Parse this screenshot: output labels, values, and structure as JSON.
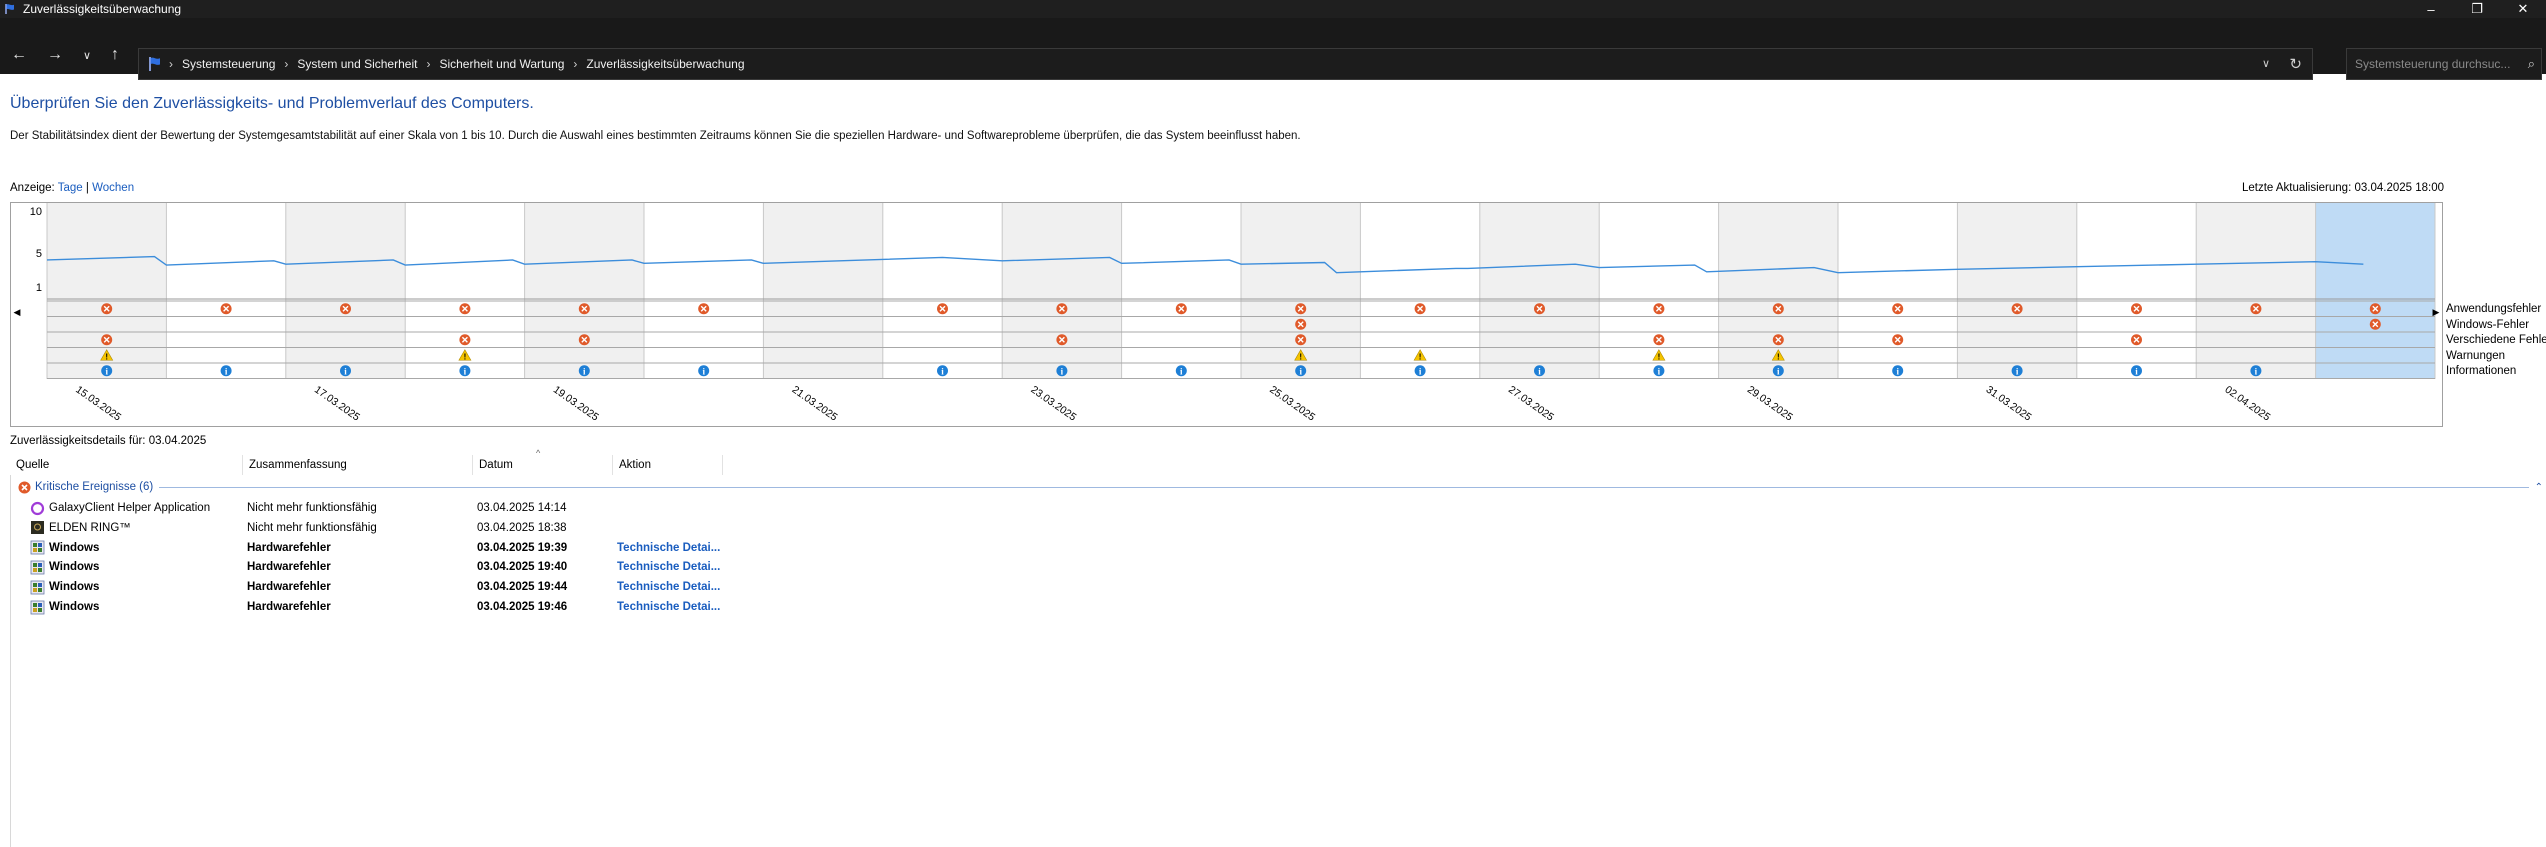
{
  "window": {
    "title": "Zuverlässigkeitsüberwachung"
  },
  "address": {
    "breadcrumbs": [
      "Systemsteuerung",
      "System und Sicherheit",
      "Sicherheit und Wartung",
      "Zuverlässigkeitsüberwachung"
    ],
    "search_placeholder": "Systemsteuerung durchsuc..."
  },
  "page": {
    "heading": "Überprüfen Sie den Zuverlässigkeits- und Problemverlauf des Computers.",
    "description": "Der Stabilitätsindex dient der Bewertung der Systemgesamtstabilität auf einer Skala von 1 bis 10. Durch die Auswahl eines bestimmten Zeitraums können Sie die speziellen Hardware- und Softwareprobleme überprüfen, die das System beeinflusst haben.",
    "view_label": "Anzeige:",
    "view_days": "Tage",
    "view_sep": "|",
    "view_weeks": "Wochen",
    "last_update": "Letzte Aktualisierung: 03.04.2025 18:00"
  },
  "chart_data": {
    "type": "line",
    "ylim": [
      1,
      10
    ],
    "yticks": [
      "10",
      "5",
      "1"
    ],
    "dates": [
      "15.03.2025",
      "16.03.2025",
      "17.03.2025",
      "18.03.2025",
      "19.03.2025",
      "20.03.2025",
      "21.03.2025",
      "22.03.2025",
      "23.03.2025",
      "24.03.2025",
      "25.03.2025",
      "26.03.2025",
      "27.03.2025",
      "28.03.2025",
      "29.03.2025",
      "30.03.2025",
      "31.03.2025",
      "01.04.2025",
      "02.04.2025",
      "03.04.2025"
    ],
    "date_labels": [
      "15.03.2025",
      "17.03.2025",
      "19.03.2025",
      "21.03.2025",
      "23.03.2025",
      "25.03.2025",
      "27.03.2025",
      "29.03.2025",
      "31.03.2025",
      "02.04.2025"
    ],
    "stability_index": [
      [
        0,
        4.2
      ],
      [
        0.9,
        4.6
      ],
      [
        1.0,
        3.6
      ],
      [
        1.9,
        4.1
      ],
      [
        2.0,
        3.7
      ],
      [
        2.9,
        4.2
      ],
      [
        3.0,
        3.6
      ],
      [
        3.9,
        4.2
      ],
      [
        4.0,
        3.7
      ],
      [
        4.9,
        4.2
      ],
      [
        5.0,
        3.8
      ],
      [
        5.9,
        4.2
      ],
      [
        6.0,
        3.8
      ],
      [
        7.5,
        4.5
      ],
      [
        8.0,
        4.1
      ],
      [
        8.9,
        4.5
      ],
      [
        9.0,
        3.8
      ],
      [
        9.9,
        4.2
      ],
      [
        10.0,
        3.7
      ],
      [
        10.7,
        3.9
      ],
      [
        10.8,
        2.7
      ],
      [
        11.8,
        3.2
      ],
      [
        11.9,
        3.2
      ],
      [
        12.8,
        3.7
      ],
      [
        13.0,
        3.3
      ],
      [
        13.8,
        3.6
      ],
      [
        13.9,
        2.8
      ],
      [
        14.8,
        3.3
      ],
      [
        15.0,
        2.7
      ],
      [
        16.0,
        3.1
      ],
      [
        17.0,
        3.4
      ],
      [
        18.0,
        3.7
      ],
      [
        19.0,
        4.0
      ],
      [
        19.4,
        3.7
      ]
    ],
    "selected_index": 19,
    "row_labels": [
      "Anwendungsfehler",
      "Windows-Fehler",
      "Verschiedene Fehle",
      "Warnungen",
      "Informationen"
    ],
    "events": {
      "Anwendungsfehler": [
        0,
        1,
        2,
        3,
        4,
        5,
        7,
        8,
        9,
        10,
        11,
        12,
        13,
        14,
        15,
        16,
        17,
        18,
        19
      ],
      "Windows-Fehler": [
        10,
        19
      ],
      "Verschiedene Fehle": [
        0,
        3,
        4,
        8,
        10,
        13,
        14,
        15,
        17
      ],
      "Warnungen": [
        0,
        3,
        10,
        11,
        13,
        14
      ],
      "Informationen": [
        0,
        1,
        2,
        3,
        4,
        5,
        7,
        8,
        9,
        10,
        11,
        12,
        13,
        14,
        15,
        16,
        17,
        18
      ]
    },
    "colors": {
      "line": "#3c8ddb",
      "error": "#e05a2a",
      "warning": "#f5c400",
      "info": "#1e7fd6",
      "selected": "#bfdbf5",
      "shade": "#f0f0f0"
    }
  },
  "details": {
    "title": "Zuverlässigkeitsdetails für: 03.04.2025",
    "columns": [
      "Quelle",
      "Zusammenfassung",
      "Datum",
      "Aktion"
    ],
    "group": "Kritische Ereignisse (6)",
    "rows": [
      {
        "icon": "galaxy-icon",
        "source": "GalaxyClient Helper Application",
        "summary": "Nicht mehr funktionsfähig",
        "date": "03.04.2025 14:14",
        "action": "",
        "bold": false
      },
      {
        "icon": "elden-ring-icon",
        "source": "ELDEN RING™",
        "summary": "Nicht mehr funktionsfähig",
        "date": "03.04.2025 18:38",
        "action": "",
        "bold": false
      },
      {
        "icon": "windows-icon",
        "source": "Windows",
        "summary": "Hardwarefehler",
        "date": "03.04.2025 19:39",
        "action": "Technische Detai...",
        "bold": true
      },
      {
        "icon": "windows-icon",
        "source": "Windows",
        "summary": "Hardwarefehler",
        "date": "03.04.2025 19:40",
        "action": "Technische Detai...",
        "bold": true
      },
      {
        "icon": "windows-icon",
        "source": "Windows",
        "summary": "Hardwarefehler",
        "date": "03.04.2025 19:44",
        "action": "Technische Detai...",
        "bold": true
      },
      {
        "icon": "windows-icon",
        "source": "Windows",
        "summary": "Hardwarefehler",
        "date": "03.04.2025 19:46",
        "action": "Technische Detai...",
        "bold": true
      }
    ]
  }
}
